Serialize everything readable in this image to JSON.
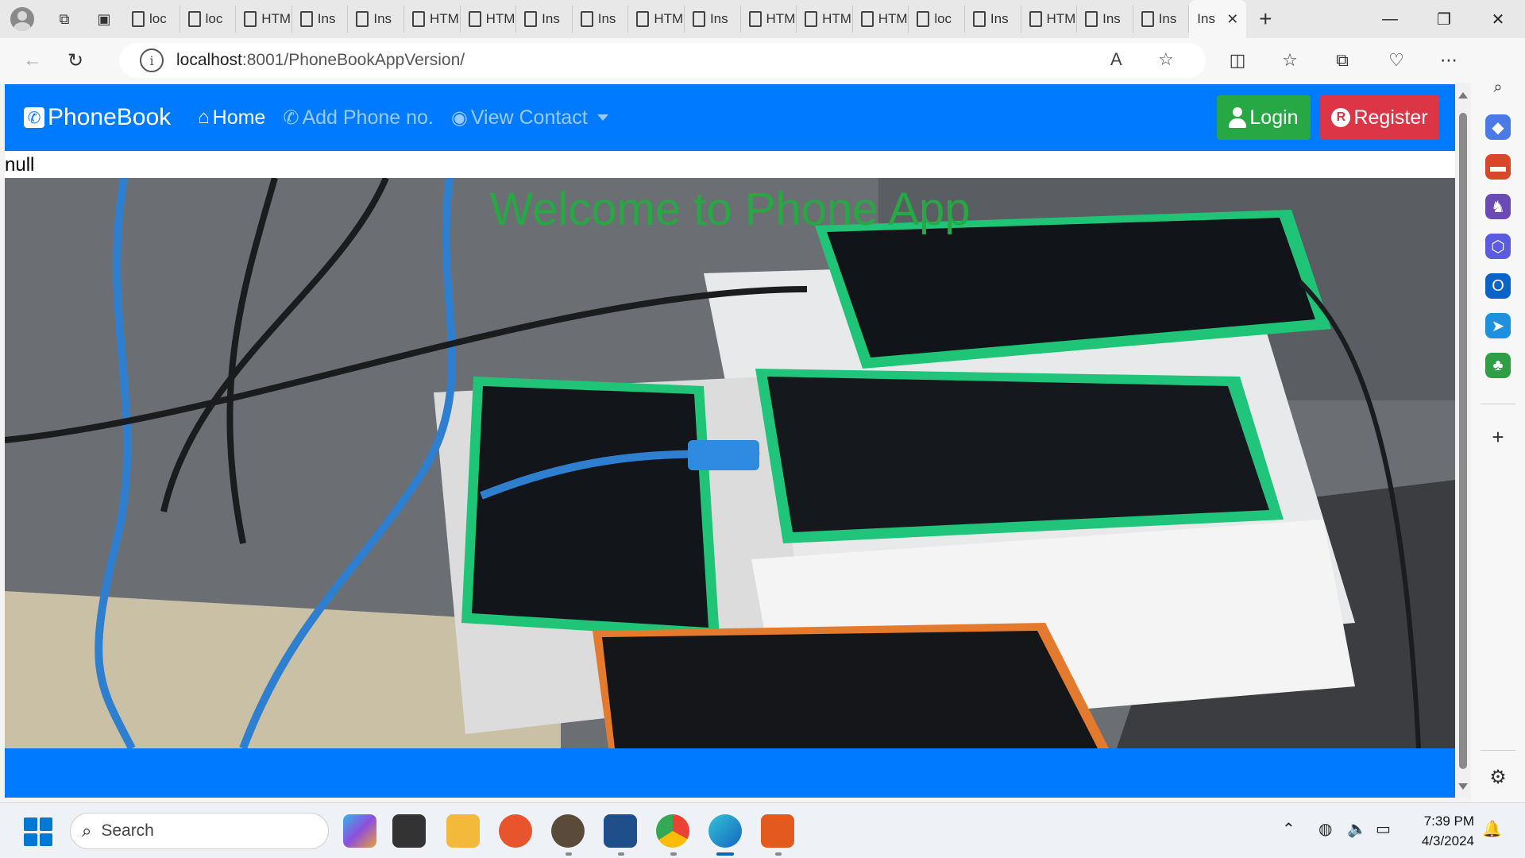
{
  "browser": {
    "tabs": [
      {
        "label": "loc"
      },
      {
        "label": "loc"
      },
      {
        "label": "HTML"
      },
      {
        "label": "Ins"
      },
      {
        "label": "Ins"
      },
      {
        "label": "HTML"
      },
      {
        "label": "HTML"
      },
      {
        "label": "Ins"
      },
      {
        "label": "Ins"
      },
      {
        "label": "HTML"
      },
      {
        "label": "Ins"
      },
      {
        "label": "HTML"
      },
      {
        "label": "HTML"
      },
      {
        "label": "HTML"
      },
      {
        "label": "loc"
      },
      {
        "label": "Ins"
      },
      {
        "label": "HTML"
      },
      {
        "label": "Ins"
      },
      {
        "label": "Ins"
      }
    ],
    "active_tab": {
      "label": "Ins"
    },
    "url_host": "localhost",
    "url_path": ":8001/PhoneBookAppVersion/"
  },
  "page": {
    "brand": "PhoneBook",
    "nav": {
      "home": "Home",
      "add_phone": "Add Phone no.",
      "view_contact": "View Contact"
    },
    "login_label": "Login",
    "register_label": "Register",
    "null_text": "null",
    "hero_title": "Welcome to Phone App",
    "colors": {
      "primary": "#007bff",
      "success": "#28a745",
      "danger": "#dc3545"
    }
  },
  "taskbar": {
    "search_label": "Search",
    "time": "7:39 PM",
    "date": "4/3/2024"
  }
}
